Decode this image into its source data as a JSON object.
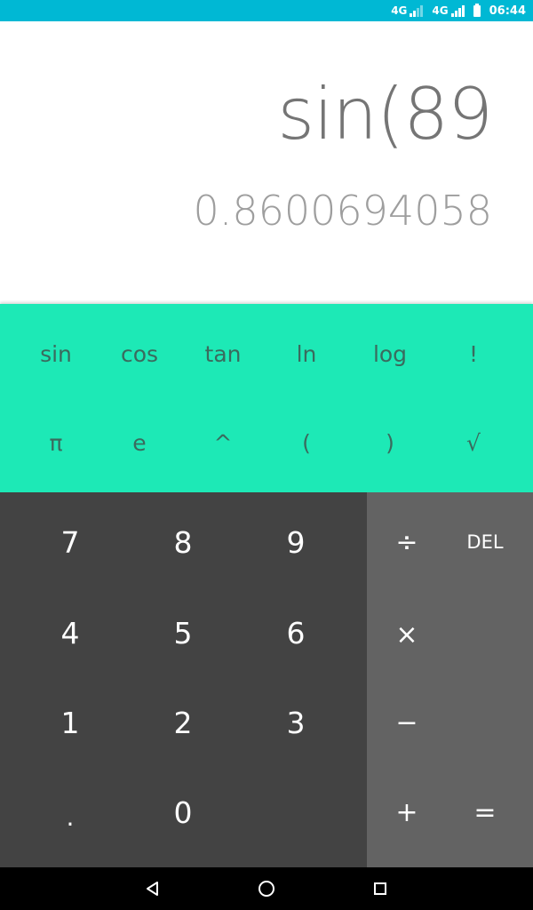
{
  "status_bar": {
    "net1": "4G",
    "net2": "4G",
    "time": "06:44"
  },
  "display": {
    "expression": "sin(89",
    "result": "0.8600694058"
  },
  "scientific_keys": {
    "row1": [
      "sin",
      "cos",
      "tan",
      "ln",
      "log",
      "!"
    ],
    "row2": [
      "π",
      "e",
      "^",
      "(",
      ")",
      "√"
    ]
  },
  "number_keys": {
    "row1": [
      "7",
      "8",
      "9"
    ],
    "row2": [
      "4",
      "5",
      "6"
    ],
    "row3": [
      "1",
      "2",
      "3"
    ],
    "row4": [
      ".",
      "0"
    ]
  },
  "operator_keys": {
    "divide": "÷",
    "delete": "DEL",
    "multiply": "×",
    "subtract": "−",
    "add": "+",
    "equals": "="
  },
  "colors": {
    "status_bar": "#00b8d4",
    "scientific_panel": "#1de9b6",
    "number_pad": "#434343",
    "operator_pad": "#636363"
  },
  "icons": {
    "nav_back": "back-triangle-icon",
    "nav_home": "home-circle-icon",
    "nav_recents": "recents-square-icon"
  }
}
